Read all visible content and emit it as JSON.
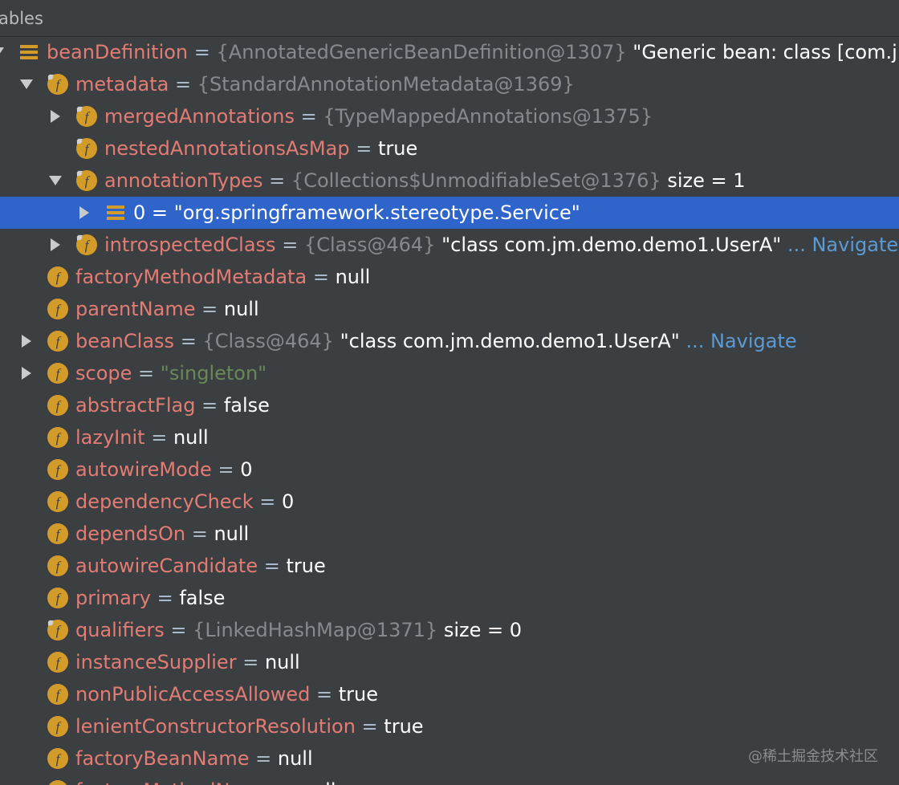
{
  "panel": {
    "title": "ables"
  },
  "watermark": "@稀土掘金技术社区",
  "colors": {
    "background": "#3c3f41",
    "field_name": "#e27c74",
    "reference": "#868a8e",
    "value": "#ffffff",
    "string": "#6a8759",
    "link": "#5b9bd5",
    "selection": "#2f65ca",
    "field_icon": "#d39c29"
  },
  "tree": {
    "rows": [
      {
        "level": 0,
        "toggle": "expanded",
        "icon": "list-icon",
        "name": "beanDefinition",
        "ref": "{AnnotatedGenericBeanDefinition@1307}",
        "value": "\"Generic bean: class [com.j",
        "value_type": "plain"
      },
      {
        "level": 1,
        "toggle": "expanded",
        "icon": "final-field-icon",
        "name": "metadata",
        "ref": "{StandardAnnotationMetadata@1369}"
      },
      {
        "level": 2,
        "toggle": "collapsed",
        "icon": "final-field-icon",
        "name": "mergedAnnotations",
        "ref": "{TypeMappedAnnotations@1375}"
      },
      {
        "level": 2,
        "toggle": "none",
        "icon": "final-field-icon",
        "name": "nestedAnnotationsAsMap",
        "value": "true",
        "value_type": "plain"
      },
      {
        "level": 2,
        "toggle": "expanded",
        "icon": "final-field-icon",
        "name": "annotationTypes",
        "ref": "{Collections$UnmodifiableSet@1376}",
        "size": "size = 1"
      },
      {
        "level": 3,
        "toggle": "collapsed",
        "icon": "list-icon",
        "name": "0",
        "value": "\"org.springframework.stereotype.Service\"",
        "value_type": "plain",
        "selected": true
      },
      {
        "level": 2,
        "toggle": "collapsed",
        "icon": "final-field-icon",
        "name": "introspectedClass",
        "ref": "{Class@464}",
        "value": "\"class com.jm.demo.demo1.UserA\"",
        "value_type": "plain",
        "ellipsis": "...",
        "link": "Navigate"
      },
      {
        "level": 1,
        "toggle": "none",
        "icon": "field-icon",
        "name": "factoryMethodMetadata",
        "value": "null",
        "value_type": "plain"
      },
      {
        "level": 1,
        "toggle": "none",
        "icon": "field-icon",
        "name": "parentName",
        "value": "null",
        "value_type": "plain"
      },
      {
        "level": 1,
        "toggle": "collapsed",
        "icon": "field-icon",
        "name": "beanClass",
        "ref": "{Class@464}",
        "value": "\"class com.jm.demo.demo1.UserA\"",
        "value_type": "plain",
        "ellipsis": "...",
        "link": "Navigate"
      },
      {
        "level": 1,
        "toggle": "collapsed",
        "icon": "field-icon",
        "name": "scope",
        "value": "\"singleton\"",
        "value_type": "string"
      },
      {
        "level": 1,
        "toggle": "none",
        "icon": "field-icon",
        "name": "abstractFlag",
        "value": "false",
        "value_type": "plain"
      },
      {
        "level": 1,
        "toggle": "none",
        "icon": "field-icon",
        "name": "lazyInit",
        "value": "null",
        "value_type": "plain"
      },
      {
        "level": 1,
        "toggle": "none",
        "icon": "field-icon",
        "name": "autowireMode",
        "value": "0",
        "value_type": "plain"
      },
      {
        "level": 1,
        "toggle": "none",
        "icon": "field-icon",
        "name": "dependencyCheck",
        "value": "0",
        "value_type": "plain"
      },
      {
        "level": 1,
        "toggle": "none",
        "icon": "field-icon",
        "name": "dependsOn",
        "value": "null",
        "value_type": "plain"
      },
      {
        "level": 1,
        "toggle": "none",
        "icon": "field-icon",
        "name": "autowireCandidate",
        "value": "true",
        "value_type": "plain"
      },
      {
        "level": 1,
        "toggle": "none",
        "icon": "field-icon",
        "name": "primary",
        "value": "false",
        "value_type": "plain"
      },
      {
        "level": 1,
        "toggle": "none",
        "icon": "final-field-icon",
        "name": "qualifiers",
        "ref": "{LinkedHashMap@1371}",
        "size": "size = 0"
      },
      {
        "level": 1,
        "toggle": "none",
        "icon": "field-icon",
        "name": "instanceSupplier",
        "value": "null",
        "value_type": "plain"
      },
      {
        "level": 1,
        "toggle": "none",
        "icon": "field-icon",
        "name": "nonPublicAccessAllowed",
        "value": "true",
        "value_type": "plain"
      },
      {
        "level": 1,
        "toggle": "none",
        "icon": "field-icon",
        "name": "lenientConstructorResolution",
        "value": "true",
        "value_type": "plain"
      },
      {
        "level": 1,
        "toggle": "none",
        "icon": "field-icon",
        "name": "factoryBeanName",
        "value": "null",
        "value_type": "plain"
      },
      {
        "level": 1,
        "toggle": "none",
        "icon": "field-icon",
        "name": "factoryMethodName",
        "value": "null",
        "value_type": "plain"
      }
    ]
  }
}
